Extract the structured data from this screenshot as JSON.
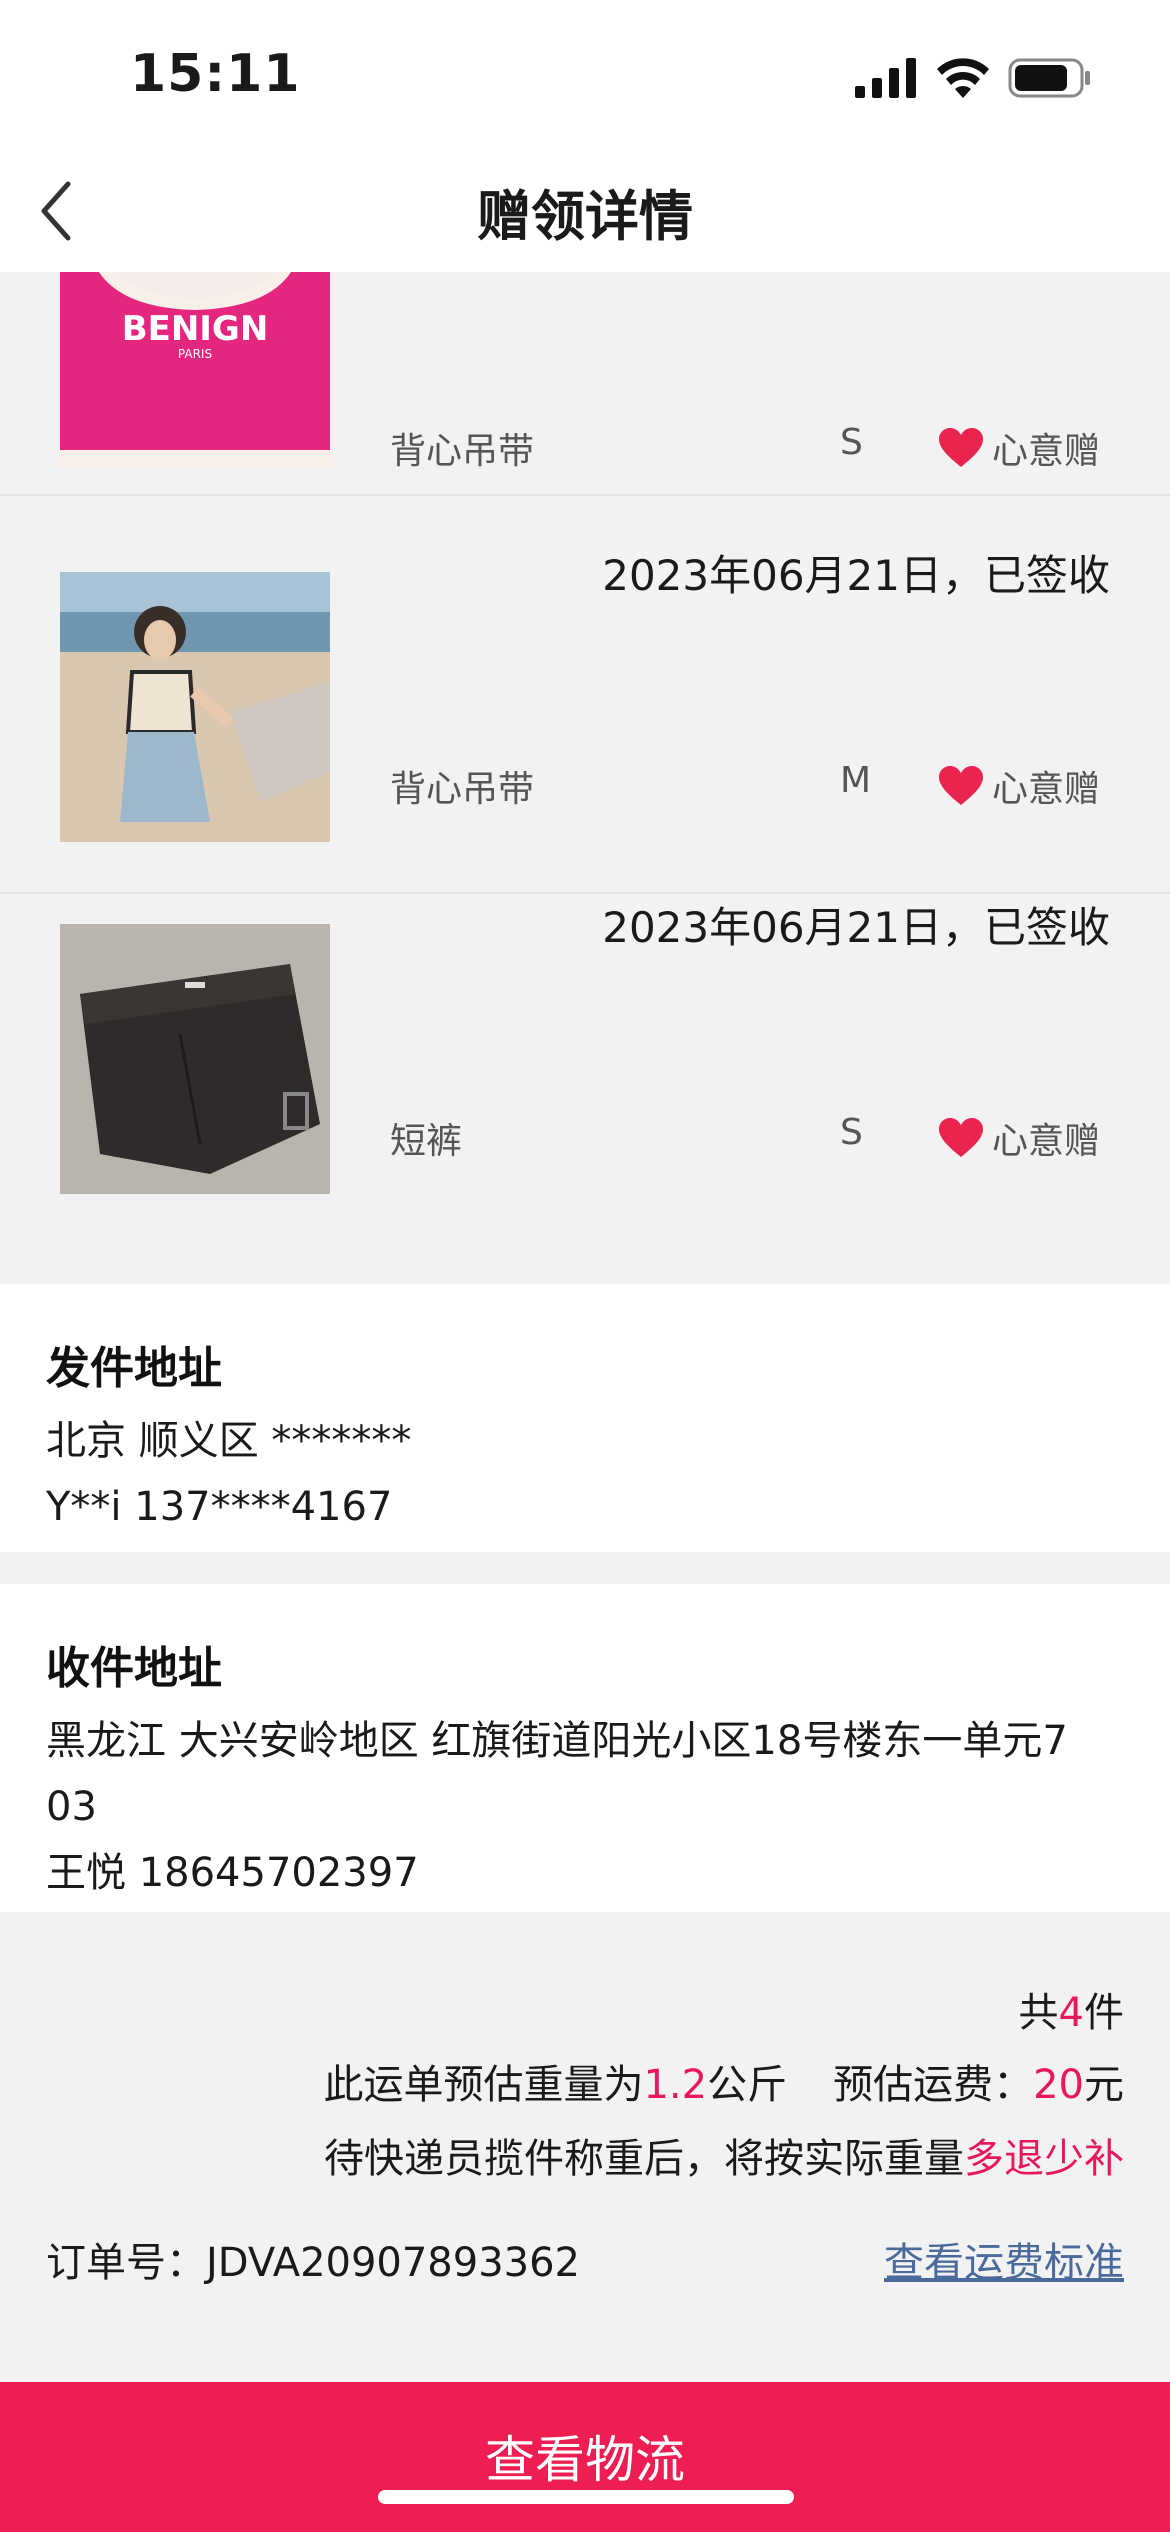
{
  "status_bar": {
    "time": "15:11"
  },
  "nav": {
    "title": "赠领详情"
  },
  "items": [
    {
      "status": "",
      "name": "背心吊带",
      "size": "S",
      "gift_label": "心意赠",
      "image_text": "BENIGN",
      "image_subtext": "PARIS"
    },
    {
      "status": "2023年06月21日，已签收",
      "name": "背心吊带",
      "size": "M",
      "gift_label": "心意赠"
    },
    {
      "status": "2023年06月21日，已签收",
      "name": "短裤",
      "size": "S",
      "gift_label": "心意赠"
    }
  ],
  "sender": {
    "title": "发件地址",
    "line1": "北京 顺义区 *******",
    "line2": "Y**i 137****4167"
  },
  "receiver": {
    "title": "收件地址",
    "line1": "黑龙江 大兴安岭地区 红旗街道阳光小区18号楼东一单元7",
    "line1b": "03",
    "line2": "王悦 18645702397"
  },
  "summary": {
    "count_prefix": "共",
    "count": "4",
    "count_suffix": "件",
    "weight_prefix": "此运单预估重量为",
    "weight": "1.2",
    "weight_unit": "公斤",
    "fee_prefix": "预估运费：",
    "fee": "20",
    "fee_unit": "元",
    "note_prefix": "待快递员揽件称重后，将按实际重量",
    "note_highlight": "多退少补",
    "order_label": "订单号：",
    "order_no": "JDVA20907893362",
    "fee_link": "查看运费标准"
  },
  "bottom": {
    "button": "查看物流"
  },
  "colors": {
    "accent": "#ee1d52",
    "highlight": "#e8195a",
    "link": "#4a6a9c",
    "heart": "#e8244f"
  }
}
